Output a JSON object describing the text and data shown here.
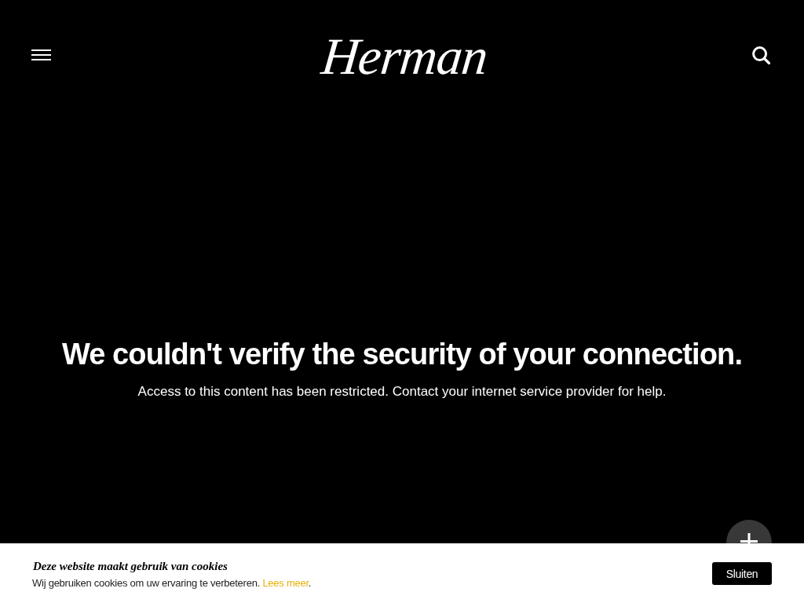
{
  "header": {
    "logo": "Herman"
  },
  "message": {
    "title": "We couldn't verify the security of your connection.",
    "body": "Access to this content has been restricted. Contact your internet service provider for help."
  },
  "cookie_bar": {
    "title": "Deze website maakt gebruik van cookies",
    "text_before": "Wij gebruiken cookies om uw ervaring te verbeteren.",
    "link": "Lees meer",
    "text_after": ".",
    "button": "Sluiten"
  }
}
